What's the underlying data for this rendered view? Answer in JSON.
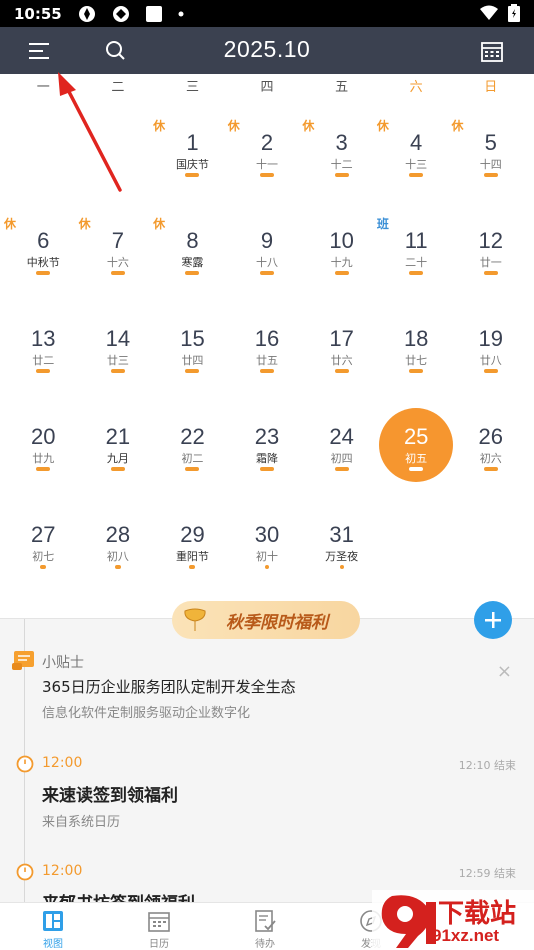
{
  "status_bar": {
    "time": "10:55"
  },
  "header": {
    "title": "2025.10"
  },
  "weekdays": [
    "一",
    "二",
    "三",
    "四",
    "五",
    "六",
    "日"
  ],
  "calendar": {
    "rows": [
      [
        null,
        null,
        {
          "day": "1",
          "lunar": "国庆节",
          "tag": "休",
          "dot": "bar",
          "festival": true
        },
        {
          "day": "2",
          "lunar": "十一",
          "tag": "休",
          "dot": "bar"
        },
        {
          "day": "3",
          "lunar": "十二",
          "tag": "休",
          "dot": "bar"
        },
        {
          "day": "4",
          "lunar": "十三",
          "tag": "休",
          "dot": "bar"
        },
        {
          "day": "5",
          "lunar": "十四",
          "tag": "休",
          "dot": "bar"
        }
      ],
      [
        {
          "day": "6",
          "lunar": "中秋节",
          "tag": "休",
          "dot": "bar",
          "festival": true
        },
        {
          "day": "7",
          "lunar": "十六",
          "tag": "休",
          "dot": "bar"
        },
        {
          "day": "8",
          "lunar": "寒露",
          "tag": "休",
          "dot": "bar",
          "festival": true
        },
        {
          "day": "9",
          "lunar": "十八",
          "dot": "bar"
        },
        {
          "day": "10",
          "lunar": "十九",
          "dot": "bar"
        },
        {
          "day": "11",
          "lunar": "二十",
          "tag": "班",
          "dot": "bar",
          "work": true
        },
        {
          "day": "12",
          "lunar": "廿一",
          "dot": "bar"
        }
      ],
      [
        {
          "day": "13",
          "lunar": "廿二",
          "dot": "bar"
        },
        {
          "day": "14",
          "lunar": "廿三",
          "dot": "bar"
        },
        {
          "day": "15",
          "lunar": "廿四",
          "dot": "bar"
        },
        {
          "day": "16",
          "lunar": "廿五",
          "dot": "bar"
        },
        {
          "day": "17",
          "lunar": "廿六",
          "dot": "bar"
        },
        {
          "day": "18",
          "lunar": "廿七",
          "dot": "bar"
        },
        {
          "day": "19",
          "lunar": "廿八",
          "dot": "bar"
        }
      ],
      [
        {
          "day": "20",
          "lunar": "廿九",
          "dot": "bar"
        },
        {
          "day": "21",
          "lunar": "九月",
          "dot": "bar",
          "festival": true
        },
        {
          "day": "22",
          "lunar": "初二",
          "dot": "bar"
        },
        {
          "day": "23",
          "lunar": "霜降",
          "dot": "bar",
          "festival": true
        },
        {
          "day": "24",
          "lunar": "初四",
          "dot": "bar"
        },
        {
          "day": "25",
          "lunar": "初五",
          "dot": "bar",
          "selected": true
        },
        {
          "day": "26",
          "lunar": "初六",
          "dot": "bar"
        }
      ],
      [
        {
          "day": "27",
          "lunar": "初七",
          "dot": "small"
        },
        {
          "day": "28",
          "lunar": "初八",
          "dot": "small"
        },
        {
          "day": "29",
          "lunar": "重阳节",
          "dot": "small",
          "festival": true
        },
        {
          "day": "30",
          "lunar": "初十",
          "dot": "tiny"
        },
        {
          "day": "31",
          "lunar": "万圣夜",
          "dot": "tiny",
          "festival": true
        },
        null,
        null
      ]
    ]
  },
  "banner": {
    "text": "秋季限时福利"
  },
  "tip": {
    "label": "小贴士",
    "title": "365日历企业服务团队定制开发全生态",
    "subtitle": "信息化软件定制服务驱动企业数字化",
    "close": "×"
  },
  "events": [
    {
      "time": "12:00",
      "end": "12:10 结束",
      "title": "来速读签到领福利",
      "source": "来自系统日历"
    },
    {
      "time": "12:00",
      "end": "12:59 结束",
      "title": "来郁书坊签到领福利",
      "source": ""
    }
  ],
  "bottom_nav": [
    {
      "label": "视图",
      "icon": "view-grid-icon",
      "active": true
    },
    {
      "label": "日历",
      "icon": "calendar-icon",
      "active": false
    },
    {
      "label": "待办",
      "icon": "todo-icon",
      "active": false
    },
    {
      "label": "发现",
      "icon": "discover-icon",
      "active": false
    }
  ],
  "watermark": {
    "brand": "下载站",
    "url": "91xz.net"
  },
  "colors": {
    "accent_orange": "#f6962f",
    "header_bg": "#3b4150",
    "fab_blue": "#2f9fe8",
    "work_blue": "#3a8fd6"
  }
}
